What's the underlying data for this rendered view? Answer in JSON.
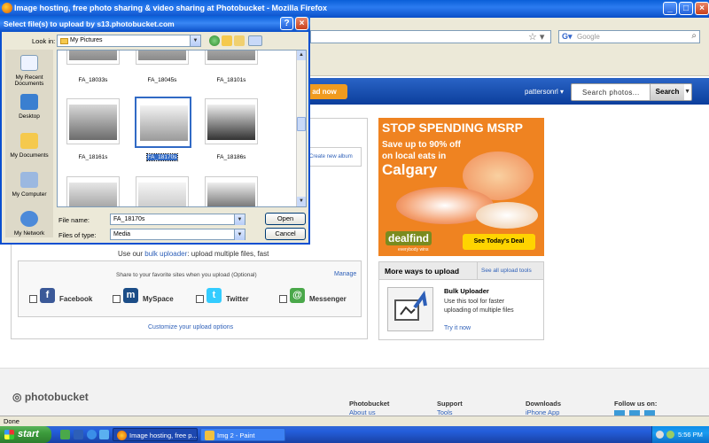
{
  "firefox": {
    "title": "Image hosting, free photo sharing & video sharing at Photobucket - Mozilla Firefox",
    "search_placeholder": "Google",
    "status": "Done"
  },
  "page": {
    "upload_now": "ad now",
    "username": "pattersonrl",
    "search_placeholder": "Search photos...",
    "search_button": "Search",
    "create_album": "Create new album",
    "multi_prefix": "Use our",
    "multi_link": "bulk uploader",
    "multi_suffix": ": upload multiple files, fast",
    "share_caption": "Share to your favorite sites when you upload (Optional)",
    "manage": "Manage",
    "share": [
      {
        "label": "Facebook",
        "icon": "f"
      },
      {
        "label": "MySpace",
        "icon": "m"
      },
      {
        "label": "Twitter",
        "icon": "t"
      },
      {
        "label": "Messenger",
        "icon": "@"
      }
    ],
    "customize": "Customize your upload options"
  },
  "ad": {
    "line1": "STOP SPENDING MSRP",
    "line2a": "Save up to 90% off",
    "line2b": "on local eats in",
    "line3": "Calgary",
    "brand": "dealfind",
    "sub": "everybody wins",
    "cta": "See Today's Deal"
  },
  "more_ways": {
    "title": "More ways to upload",
    "see_all": "See all upload tools",
    "tool_title": "Bulk Uploader",
    "tool_desc": "Use this tool for faster uploading of multiple files",
    "try": "Try it now"
  },
  "footer": {
    "logo": "photobucket",
    "cols": [
      {
        "h": "Photobucket",
        "l": "About us"
      },
      {
        "h": "Support",
        "l": "Tools"
      },
      {
        "h": "Downloads",
        "l": "iPhone App"
      },
      {
        "h": "Follow us on:",
        "l": ""
      }
    ]
  },
  "dialog": {
    "title": "Select file(s) to upload by s13.photobucket.com",
    "look_in_label": "Look in:",
    "look_in": "My Pictures",
    "places": [
      "My Recent Documents",
      "Desktop",
      "My Documents",
      "My Computer",
      "My Network"
    ],
    "files": [
      "FA_18033s",
      "FA_18045s",
      "FA_18101s",
      "FA_18161s",
      "FA_18170s",
      "FA_18186s",
      "",
      "",
      ""
    ],
    "file_name_label": "File name:",
    "file_name": "FA_18170s",
    "file_type_label": "Files of type:",
    "file_type": "Media",
    "open": "Open",
    "cancel": "Cancel"
  },
  "taskbar": {
    "start": "start",
    "tasks": [
      "Image hosting, free p...",
      "Img 2 - Paint"
    ],
    "clock": "5:56 PM"
  }
}
